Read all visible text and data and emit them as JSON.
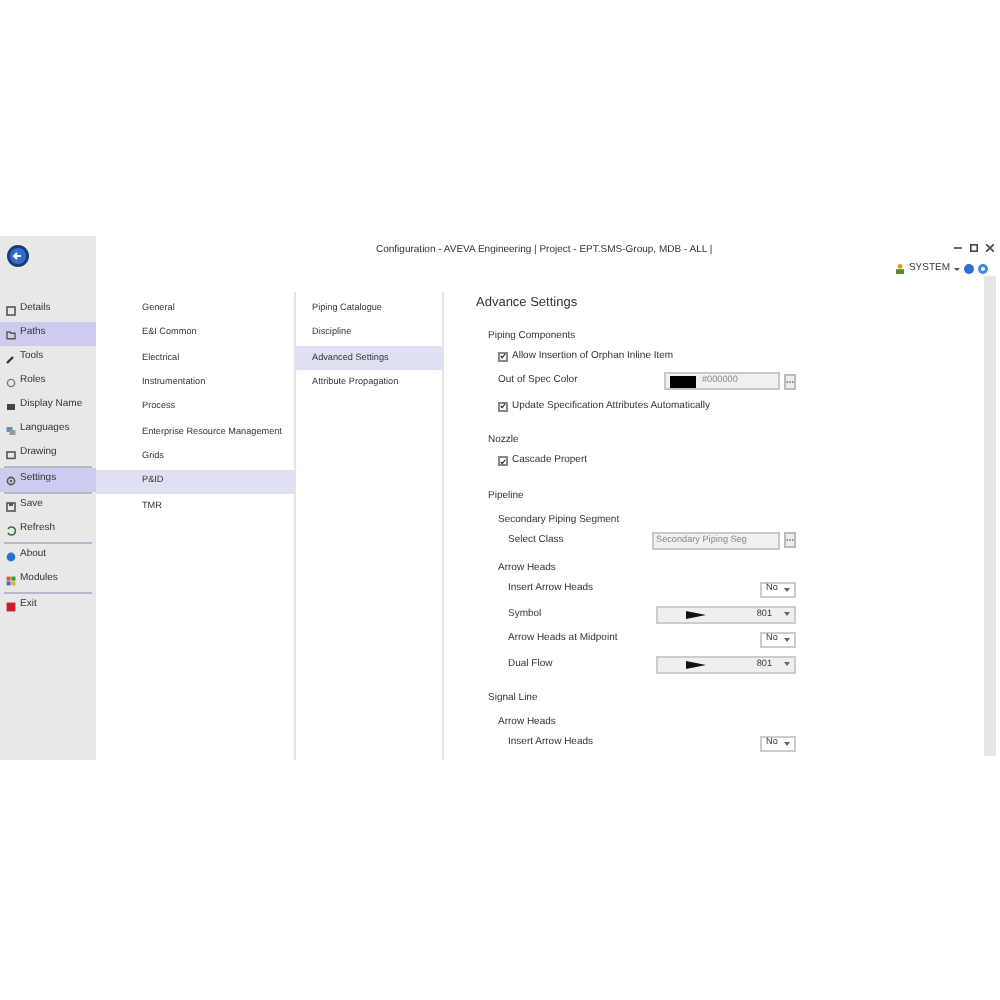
{
  "window": {
    "title": "Configuration - AVEVA Engineering | Project - EPT.SMS-Group, MDB - ALL |"
  },
  "user": {
    "name": "SYSTEM"
  },
  "sidebar": {
    "groups": [
      [
        {
          "label": "Details",
          "selected": false
        },
        {
          "label": "Paths",
          "selected": true
        },
        {
          "label": "Tools",
          "selected": false
        },
        {
          "label": "Roles",
          "selected": false
        },
        {
          "label": "Display Name",
          "selected": false
        },
        {
          "label": "Languages",
          "selected": false
        },
        {
          "label": "Drawing",
          "selected": false
        }
      ],
      [
        {
          "label": "Settings",
          "selected": true
        }
      ],
      [
        {
          "label": "Save",
          "selected": false
        },
        {
          "label": "Refresh",
          "selected": false
        }
      ],
      [
        {
          "label": "About",
          "selected": false
        },
        {
          "label": "Modules",
          "selected": false
        }
      ],
      [
        {
          "label": "Exit",
          "selected": false
        }
      ]
    ]
  },
  "categories": [
    {
      "label": "General",
      "selected": false
    },
    {
      "label": "E&I Common",
      "selected": false
    },
    {
      "label": "Electrical",
      "selected": false
    },
    {
      "label": "Instrumentation",
      "selected": false
    },
    {
      "label": "Process",
      "selected": false
    },
    {
      "label": "Enterprise Resource Management",
      "selected": false
    },
    {
      "label": "Grids",
      "selected": false
    },
    {
      "label": "P&ID",
      "selected": true
    },
    {
      "label": "TMR",
      "selected": false
    }
  ],
  "subcategories": [
    {
      "label": "Piping Catalogue",
      "selected": false
    },
    {
      "label": "Discipline",
      "selected": false
    },
    {
      "label": "Advanced Settings",
      "selected": true
    },
    {
      "label": "Attribute Propagation",
      "selected": false
    }
  ],
  "settings": {
    "title": "Advance Settings",
    "sections": [
      {
        "kind": "group",
        "label": "Piping Components",
        "children": [
          {
            "kind": "checkbox",
            "label": "Allow Insertion of Orphan Inline Item",
            "checked": true
          },
          {
            "kind": "color",
            "label": "Out of Spec Color",
            "value": "#000000"
          },
          {
            "kind": "checkbox",
            "label": "Update Specification Attributes Automatically",
            "checked": true
          }
        ]
      },
      {
        "kind": "group",
        "label": "Nozzle",
        "children": [
          {
            "kind": "checkbox",
            "label": "Cascade Propert",
            "checked": true
          }
        ]
      },
      {
        "kind": "group",
        "label": "Pipeline",
        "children": [
          {
            "kind": "group",
            "label": "Secondary Piping Segment",
            "children": [
              {
                "kind": "picker",
                "label": "Select Class",
                "value": "Secondary Piping Seg"
              }
            ]
          },
          {
            "kind": "group",
            "label": "Arrow Heads",
            "children": [
              {
                "kind": "dropdown",
                "label": "Insert Arrow Heads",
                "value": "No"
              },
              {
                "kind": "symbol",
                "label": "Symbol",
                "value": "801"
              },
              {
                "kind": "dropdown",
                "label": "Arrow Heads at Midpoint",
                "value": "No"
              },
              {
                "kind": "symbol",
                "label": "Dual Flow",
                "value": "801"
              }
            ]
          }
        ]
      },
      {
        "kind": "group",
        "label": "Signal Line",
        "children": [
          {
            "kind": "group",
            "label": "Arrow Heads",
            "children": [
              {
                "kind": "dropdown",
                "label": "Insert Arrow Heads",
                "value": "No"
              }
            ]
          }
        ]
      }
    ]
  }
}
